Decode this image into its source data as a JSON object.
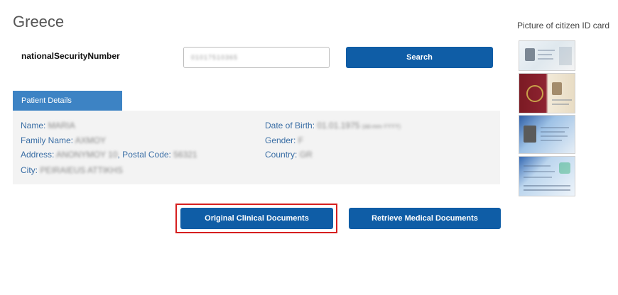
{
  "page": {
    "country_title": "Greece"
  },
  "search": {
    "label": "nationalSecurityNumber",
    "input_value": "01017510365",
    "button_label": "Search"
  },
  "patient_details": {
    "tab_label": "Patient Details",
    "name_label": "Name:",
    "name_value": "MARIA",
    "family_name_label": "Family Name:",
    "family_name_value": "AXMOY",
    "address_label": "Address:",
    "address_value": "ANONYMOY 10",
    "postal_code_label": ", Postal Code:",
    "postal_code_value": "56321",
    "city_label": "City:",
    "city_value": "PEIRAIEUS ATTIKHS",
    "dob_label": "Date of Birth:",
    "dob_value": "01.01.1975",
    "dob_format": "(dd-mm-YYYY)",
    "gender_label": "Gender:",
    "gender_value": "F",
    "country_label": "Country:",
    "country_value": "GR"
  },
  "actions": {
    "original_docs_label": "Original Clinical Documents",
    "retrieve_docs_label": "Retrieve Medical Documents"
  },
  "id_cards": {
    "title": "Picture of citizen ID card"
  },
  "colors": {
    "primary_button": "#0f5da6",
    "tab": "#3d83c4",
    "field_label": "#3a6ea5",
    "highlight": "#d61f1f",
    "panel_bg": "#f3f3f3"
  }
}
